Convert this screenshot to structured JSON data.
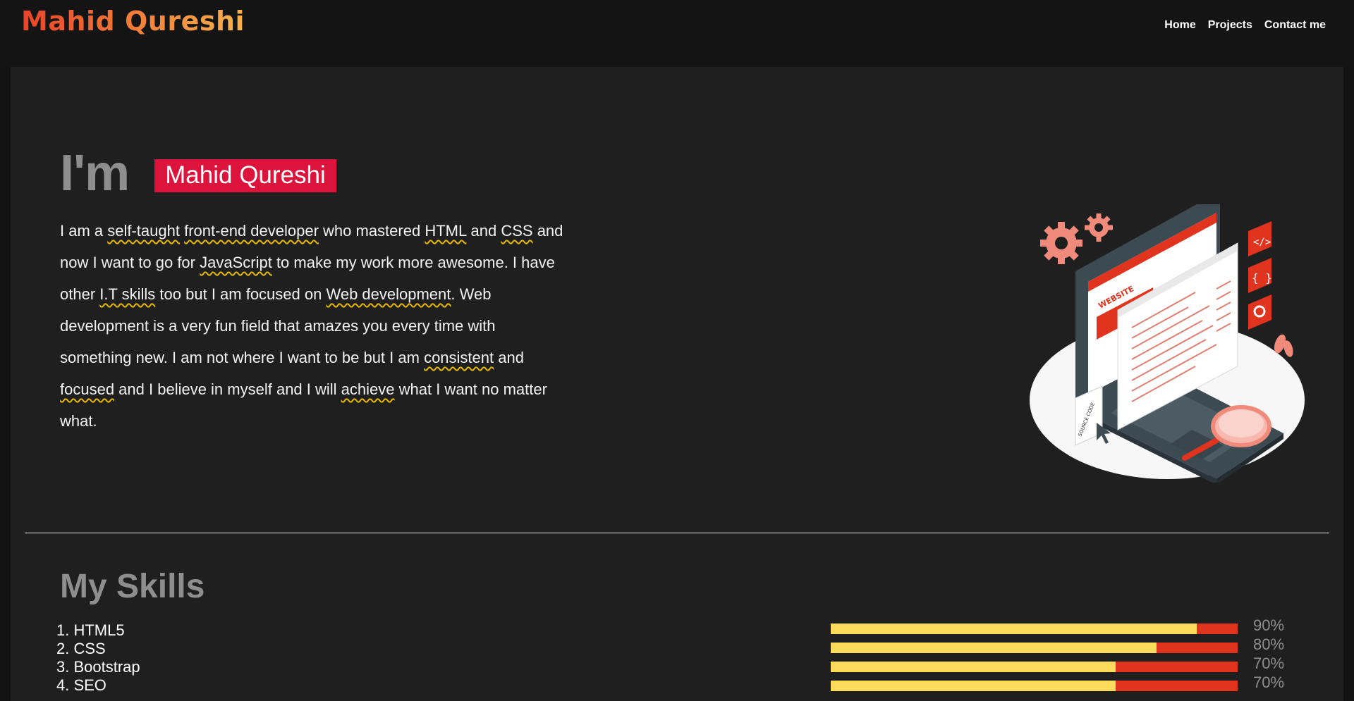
{
  "header": {
    "logo": "Mahid Qureshi",
    "nav": [
      "Home",
      "Projects",
      "Contact me"
    ]
  },
  "intro": {
    "im": "I'm",
    "name": "Mahid Qureshi",
    "bio": [
      {
        "t": "I am a ",
        "k": false
      },
      {
        "t": "self-taught",
        "k": true
      },
      {
        "t": " ",
        "k": false
      },
      {
        "t": "front-end developer",
        "k": true
      },
      {
        "t": " who mastered ",
        "k": false
      },
      {
        "t": "HTML",
        "k": true
      },
      {
        "t": " and ",
        "k": false
      },
      {
        "t": "CSS",
        "k": true
      },
      {
        "t": " and now I want to go for ",
        "k": false
      },
      {
        "t": "JavaScript",
        "k": true
      },
      {
        "t": " to make my work more awesome. I have other ",
        "k": false
      },
      {
        "t": "I.T skills",
        "k": true
      },
      {
        "t": " too but I am focused on ",
        "k": false
      },
      {
        "t": "Web development",
        "k": true
      },
      {
        "t": ". Web development is a very fun field that amazes you every time with something new. I am not where I want to be but I am ",
        "k": false
      },
      {
        "t": "consistent",
        "k": true
      },
      {
        "t": " and ",
        "k": false
      },
      {
        "t": "focused",
        "k": true
      },
      {
        "t": " and I believe in myself and I will ",
        "k": false
      },
      {
        "t": "achieve",
        "k": true
      },
      {
        "t": " what I want no matter what.",
        "k": false
      }
    ]
  },
  "illustration": {
    "website_label": "WEBSITE",
    "source_code_label": "SOURCE CODE",
    "code_tag": "</>",
    "braces": "{ }"
  },
  "skills": {
    "title": "My Skills",
    "items": [
      {
        "label": "1. HTML5",
        "pct_label": "90%",
        "level": 0.9
      },
      {
        "label": "2. CSS",
        "pct_label": "80%",
        "level": 0.8
      },
      {
        "label": "3. Bootstrap",
        "pct_label": "70%",
        "level": 0.7
      },
      {
        "label": "4. SEO",
        "pct_label": "70%",
        "level": 0.7
      }
    ]
  },
  "colors": {
    "name_badge": "#dc143c",
    "keyword_underline": "#e6b800",
    "bar_fill": "#fddc5c",
    "bar_track": "#e0341e",
    "logo_gradient": [
      "#e8432a",
      "#f7b24c"
    ]
  }
}
